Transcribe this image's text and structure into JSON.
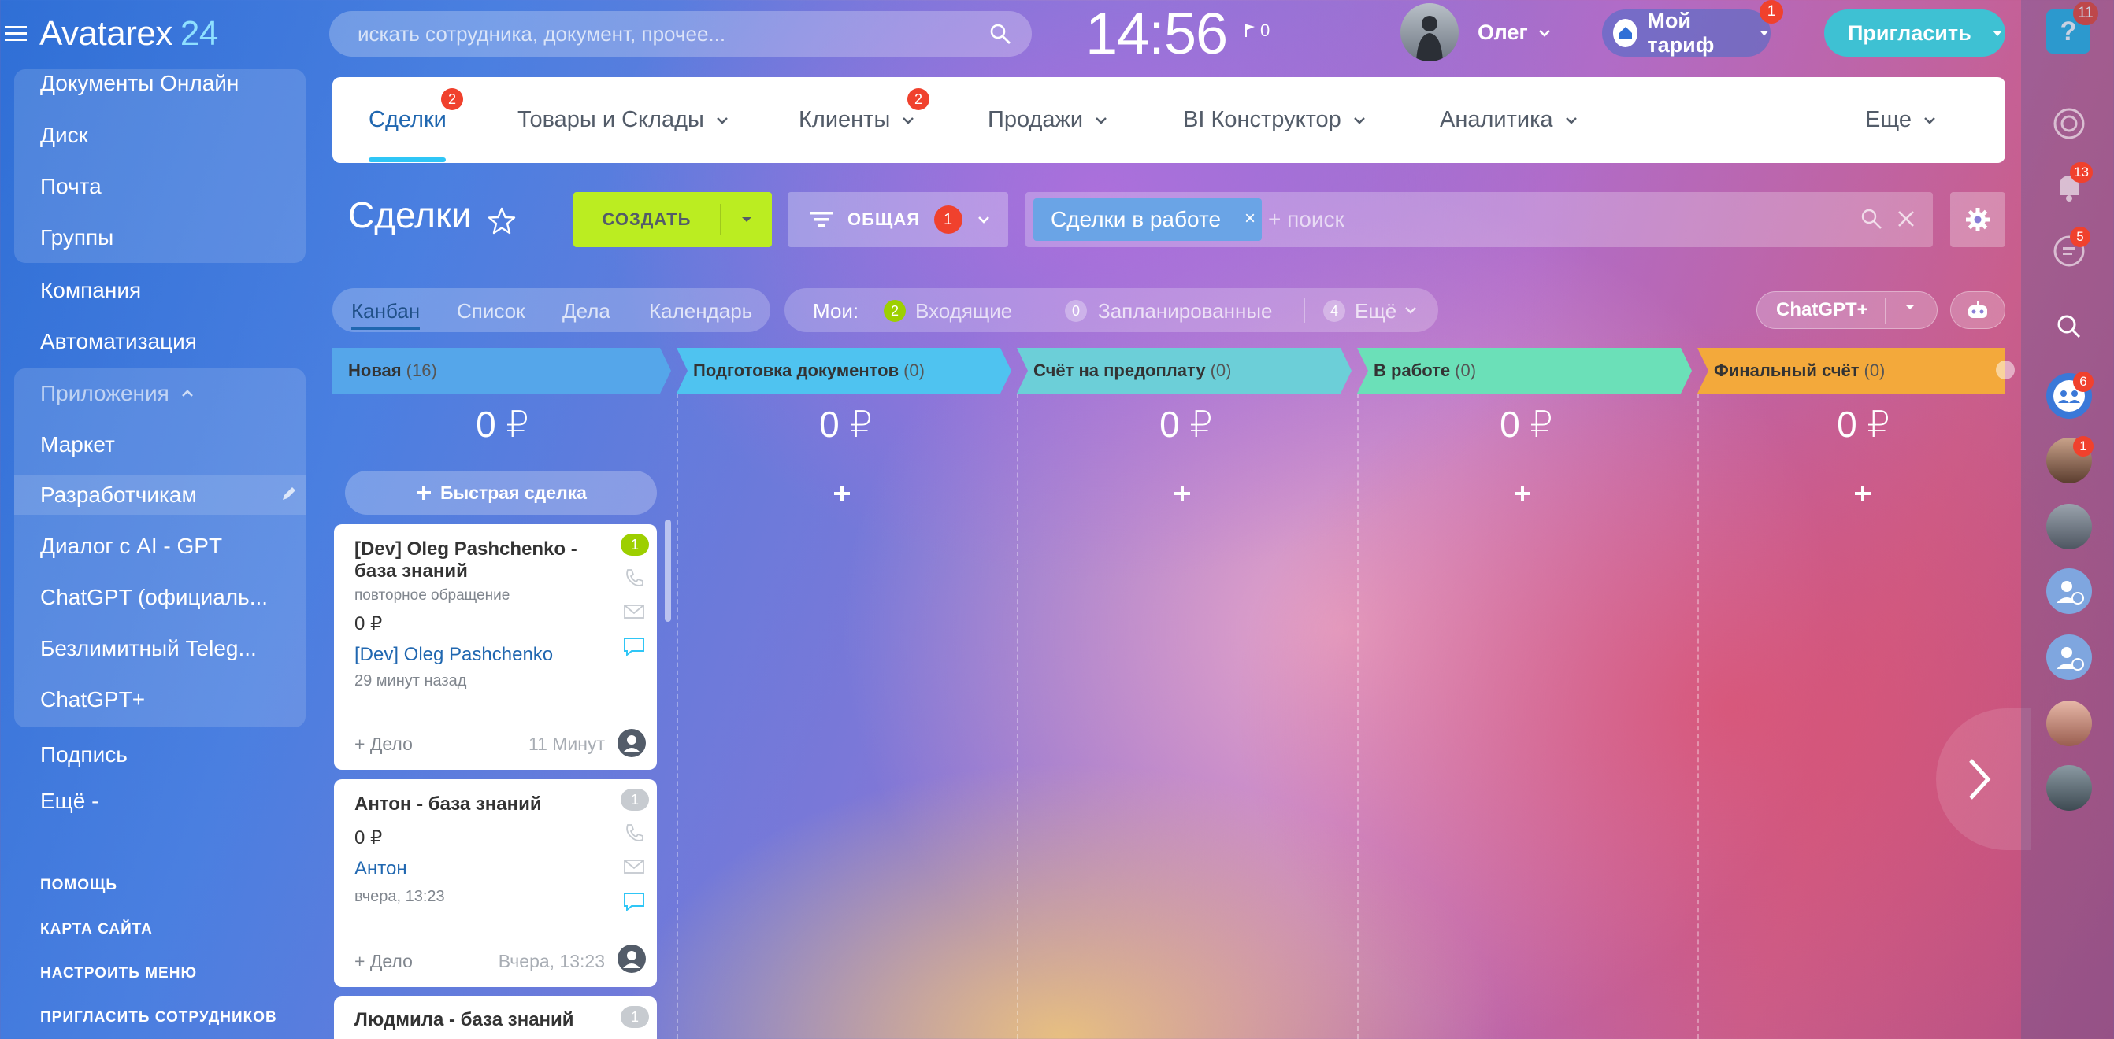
{
  "header": {
    "logo_text": "Avatarex",
    "logo_num": "24",
    "search_placeholder": "искать сотрудника, документ, прочее...",
    "clock": "14:56",
    "flag_count": "0",
    "user_name": "Олег",
    "tariff_label": "Мой тариф",
    "tariff_badge": "1",
    "invite_label": "Пригласить",
    "help_badge": "11"
  },
  "sidebar": {
    "items": [
      {
        "label": "Документы Онлайн"
      },
      {
        "label": "Диск"
      },
      {
        "label": "Почта"
      },
      {
        "label": "Группы"
      },
      {
        "label": "Компания"
      },
      {
        "label": "Автоматизация"
      },
      {
        "label": "Приложения"
      },
      {
        "label": "Маркет"
      },
      {
        "label": "Разработчикам"
      },
      {
        "label": "Диалог с AI - GPT"
      },
      {
        "label": "ChatGPT (официаль..."
      },
      {
        "label": "Безлимитный Teleg..."
      },
      {
        "label": "ChatGPT+"
      },
      {
        "label": "Подпись"
      },
      {
        "label": "Ещё -"
      }
    ],
    "footer": [
      {
        "label": "ПОМОЩЬ"
      },
      {
        "label": "КАРТА САЙТА"
      },
      {
        "label": "НАСТРОИТЬ МЕНЮ"
      },
      {
        "label": "ПРИГЛАСИТЬ СОТРУДНИКОВ"
      }
    ]
  },
  "nav": {
    "tabs": [
      {
        "label": "Сделки",
        "badge": "2"
      },
      {
        "label": "Товары и Склады"
      },
      {
        "label": "Клиенты",
        "badge": "2"
      },
      {
        "label": "Продажи"
      },
      {
        "label": "BI Конструктор"
      },
      {
        "label": "Аналитика"
      },
      {
        "label": "Еще"
      }
    ]
  },
  "toolbar": {
    "title": "Сделки",
    "create_label": "СОЗДАТЬ",
    "filter_label": "ОБЩАЯ",
    "filter_count": "1",
    "chip_label": "Сделки в работе",
    "search_placeholder": "+ поиск"
  },
  "views": {
    "tabs": [
      {
        "label": "Канбан"
      },
      {
        "label": "Список"
      },
      {
        "label": "Дела"
      },
      {
        "label": "Календарь"
      }
    ],
    "mine_label": "Мои:",
    "incoming_count": "2",
    "incoming_label": "Входящие",
    "planned_count": "0",
    "planned_label": "Запланированные",
    "more_count": "4",
    "more_label": "Ещё",
    "gpt_label": "ChatGPT+"
  },
  "columns": [
    {
      "name": "Новая",
      "count": "(16)",
      "sum": "0 ₽",
      "color": "#55a6ea"
    },
    {
      "name": "Подготовка документов",
      "count": "(0)",
      "sum": "0 ₽",
      "color": "#4fc3f0"
    },
    {
      "name": "Счёт на предоплату",
      "count": "(0)",
      "sum": "0 ₽",
      "color": "#6ccfd8"
    },
    {
      "name": "В работе",
      "count": "(0)",
      "sum": "0 ₽",
      "color": "#6be0b8"
    },
    {
      "name": "Финальный счёт",
      "count": "(0)",
      "sum": "0 ₽",
      "color": "#f3a93b"
    }
  ],
  "quick_deal": "Быстрая сделка",
  "cards": [
    {
      "title": "[Dev] Oleg Pashchenko - база знаний",
      "subtitle": "повторное обращение",
      "sum": "0 ₽",
      "contact": "[Dev] Oleg Pashchenko",
      "time": "29 минут назад",
      "deal": "+ Дело",
      "ago": "11 Минут",
      "count": "1",
      "count_color": "#9dcf00"
    },
    {
      "title": "Антон - база знаний",
      "subtitle": "",
      "sum": "0 ₽",
      "contact": "Антон",
      "time": "вчера, 13:23",
      "deal": "+ Дело",
      "ago": "Вчера, 13:23",
      "count": "1",
      "count_color": "#c7cbd0"
    },
    {
      "title": "Людмила - база знаний",
      "count": "1",
      "count_color": "#c7cbd0"
    }
  ],
  "right_panel": {
    "badges": [
      "13",
      "5",
      "6",
      "1"
    ]
  }
}
